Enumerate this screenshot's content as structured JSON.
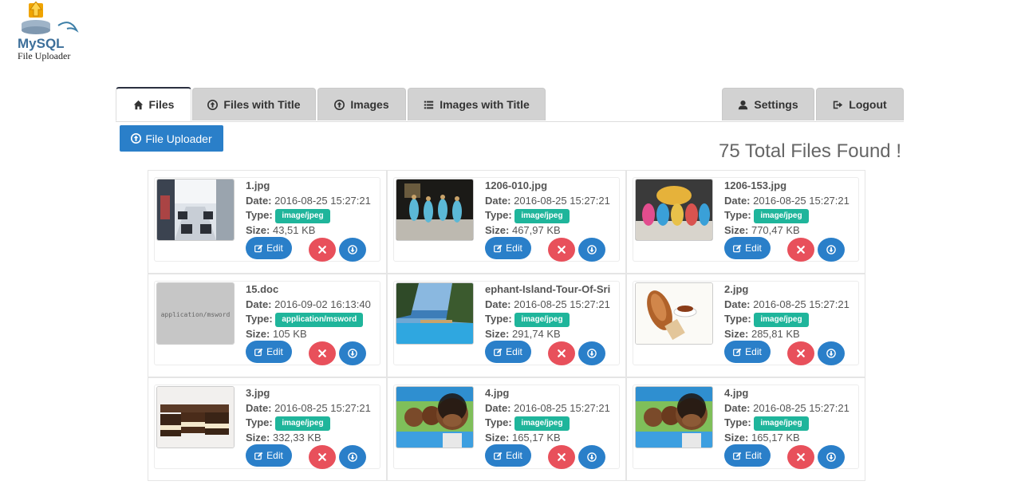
{
  "brand": {
    "logo_text": "MySQL",
    "subtitle": "File Uploader"
  },
  "tabs": [
    {
      "label": "Files",
      "icon": "home-icon",
      "active": true
    },
    {
      "label": "Files with Title",
      "icon": "upload-circle-icon"
    },
    {
      "label": "Images",
      "icon": "upload-circle-icon"
    },
    {
      "label": "Images with Title",
      "icon": "list-icon"
    }
  ],
  "right_tabs": [
    {
      "label": "Settings",
      "icon": "user-icon"
    },
    {
      "label": "Logout",
      "icon": "logout-icon"
    }
  ],
  "uploader_button": "File Uploader",
  "total_text": "75 Total Files Found !",
  "labels": {
    "date": "Date:",
    "type": "Type:",
    "size": "Size:",
    "edit": "Edit"
  },
  "colors": {
    "primary": "#2a7fc9",
    "danger": "#e8505b",
    "badge": "#1fb59b",
    "tab": "#d2d2d2"
  },
  "files": [
    {
      "name": "1.jpg",
      "date": "2016-08-25 15:27:21",
      "type": "image/jpeg",
      "size": "43,51 KB",
      "thumb": "office"
    },
    {
      "name": "1206-010.jpg",
      "date": "2016-08-25 15:27:21",
      "type": "image/jpeg",
      "size": "467,97 KB",
      "thumb": "dancers"
    },
    {
      "name": "1206-153.jpg",
      "date": "2016-08-25 15:27:21",
      "type": "image/jpeg",
      "size": "770,47 KB",
      "thumb": "dancers2"
    },
    {
      "name": "15.doc",
      "date": "2016-09-02 16:13:40",
      "type": "application/msword",
      "size": "105 KB",
      "thumb": "doc",
      "thumb_text": "application/msword"
    },
    {
      "name": "ephant-Island-Tour-Of-Sri",
      "date": "2016-08-25 15:27:21",
      "type": "image/jpeg",
      "size": "291,74 KB",
      "thumb": "pool"
    },
    {
      "name": "2.jpg",
      "date": "2016-08-25 15:27:21",
      "type": "image/jpeg",
      "size": "285,81 KB",
      "thumb": "bread"
    },
    {
      "name": "3.jpg",
      "date": "2016-08-25 15:27:21",
      "type": "image/jpeg",
      "size": "332,33 KB",
      "thumb": "cake"
    },
    {
      "name": "4.jpg",
      "date": "2016-08-25 15:27:21",
      "type": "image/jpeg",
      "size": "165,17 KB",
      "thumb": "kids"
    },
    {
      "name": "4.jpg",
      "date": "2016-08-25 15:27:21",
      "type": "image/jpeg",
      "size": "165,17 KB",
      "thumb": "kids"
    }
  ]
}
